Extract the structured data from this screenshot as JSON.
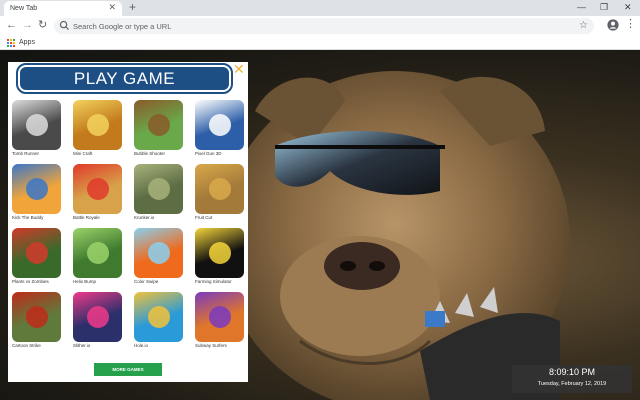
{
  "browser": {
    "tab_title": "New Tab",
    "tab_close": "✕",
    "new_tab": "+",
    "omnibox_placeholder": "Search Google or type a URL",
    "bookmark_apps": "Apps",
    "window_controls": [
      "—",
      "❐",
      "✕"
    ],
    "nav": [
      "←",
      "→",
      "↻"
    ],
    "star": "☆",
    "menu": "⋮"
  },
  "panel": {
    "banner": "PLAY GAME",
    "close": "✕",
    "more_button": "MORE GAMES",
    "games": [
      {
        "name": "Tomb Runner",
        "bg": "#4a4a4a",
        "fg": "#dddddd"
      },
      {
        "name": "Mini Craft",
        "bg": "#c27a1c",
        "fg": "#f2d25c"
      },
      {
        "name": "Bubble Shooter",
        "bg": "#69a94a",
        "fg": "#8a5a2a"
      },
      {
        "name": "Pixel Gun 3D",
        "bg": "#2d5fa8",
        "fg": "#ffffff"
      },
      {
        "name": "Kick The Buddy",
        "bg": "#f0a43a",
        "fg": "#3a77c8"
      },
      {
        "name": "Battle Royale",
        "bg": "#d7a24a",
        "fg": "#e03a2a"
      },
      {
        "name": "Krunker.io",
        "bg": "#5d6d44",
        "fg": "#a8b27a"
      },
      {
        "name": "Fruit Cut",
        "bg": "#a47a3a",
        "fg": "#d9a94a"
      },
      {
        "name": "Plants vs Zombies",
        "bg": "#3a6a2a",
        "fg": "#d23a2a"
      },
      {
        "name": "Helix Bump",
        "bg": "#3f7a2e",
        "fg": "#9bd36a"
      },
      {
        "name": "Color Swipe",
        "bg": "#ef6a1c",
        "fg": "#8ad0f0"
      },
      {
        "name": "Farming Simulator",
        "bg": "#111111",
        "fg": "#f5d53a"
      },
      {
        "name": "Cartoon Strike",
        "bg": "#5f7a3a",
        "fg": "#c02a1a"
      },
      {
        "name": "Slither.io",
        "bg": "#2b2f6a",
        "fg": "#f03a8a"
      },
      {
        "name": "Hole.io",
        "bg": "#2a9ad8",
        "fg": "#f2c23a"
      },
      {
        "name": "Subway Surfers",
        "bg": "#e0762a",
        "fg": "#7a3ac0"
      }
    ]
  },
  "clock": {
    "time": "8:09:10 PM",
    "date": "Tuesday, February 12, 2019"
  },
  "colors": {
    "banner": "#1d4f84",
    "close": "#f3b43a",
    "more_button": "#26a04b"
  }
}
